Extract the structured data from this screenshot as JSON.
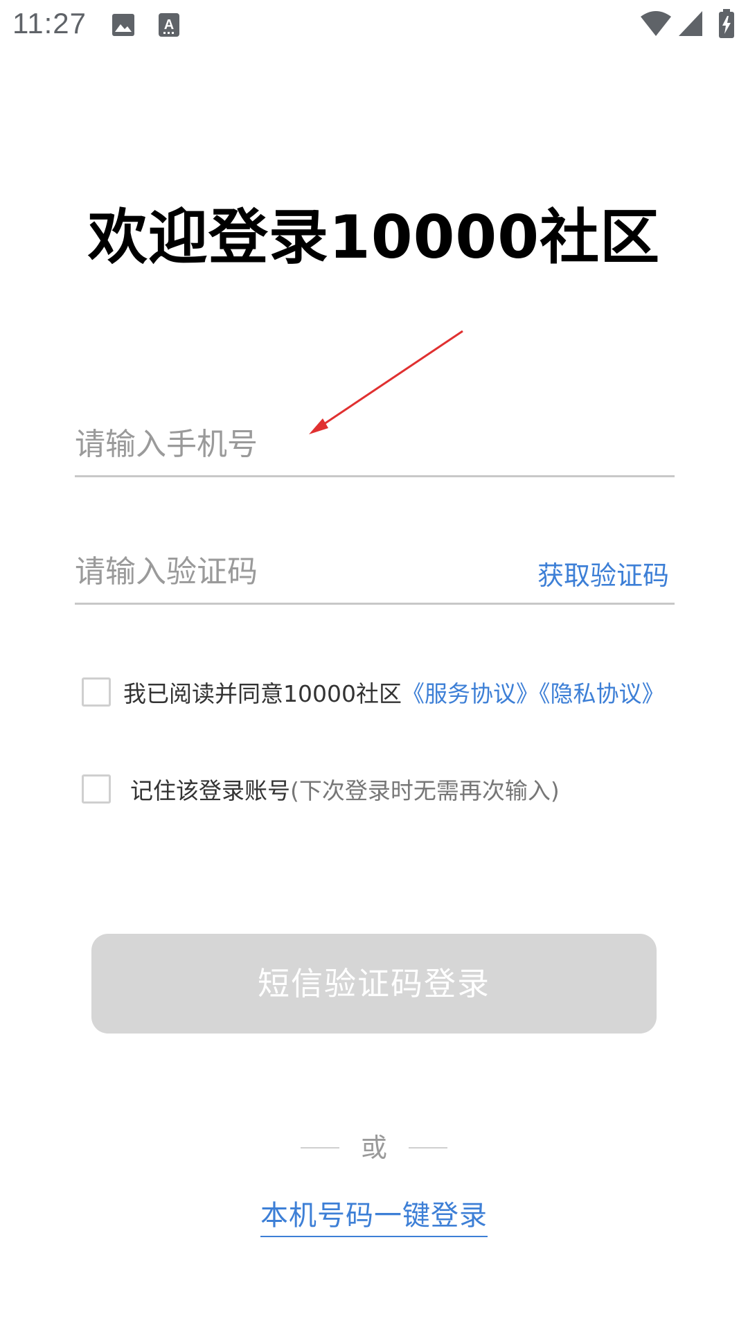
{
  "status_bar": {
    "time": "11:27",
    "icons": [
      "image-icon",
      "text-a-icon",
      "wifi-icon",
      "signal-icon",
      "battery-charging-icon"
    ]
  },
  "title": "欢迎登录10000社区",
  "phone_input": {
    "placeholder": "请输入手机号",
    "value": ""
  },
  "code_input": {
    "placeholder": "请输入验证码",
    "value": ""
  },
  "get_code_label": "获取验证码",
  "agreement": {
    "prefix": "我已阅读并同意10000社区",
    "service_link": "《服务协议》",
    "privacy_link": "《隐私协议》",
    "checked": false
  },
  "remember": {
    "label": "记住该登录账号",
    "hint": "(下次登录时无需再次输入)",
    "checked": false
  },
  "sms_login_label": "短信验证码登录",
  "or_label": "或",
  "onekey_login_label": "本机号码一键登录",
  "colors": {
    "link": "#3d7fd6",
    "button_disabled": "#d6d6d6",
    "annotation_arrow": "#e03030"
  }
}
